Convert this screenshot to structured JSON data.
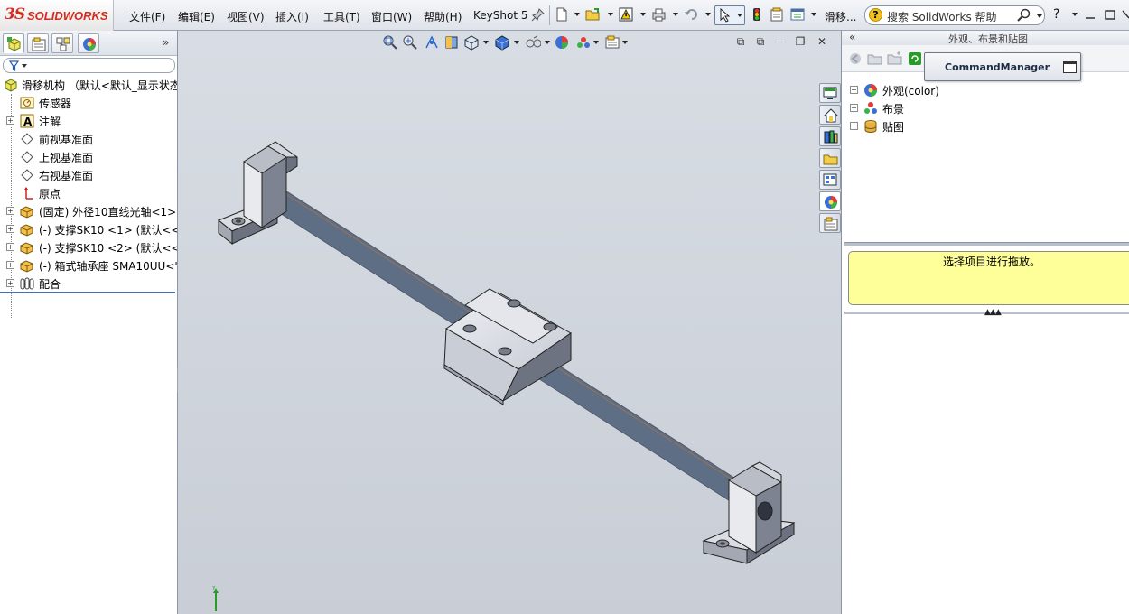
{
  "app": {
    "logo_text": "SOLIDWORKS",
    "logo_ds": "3S"
  },
  "menubar": {
    "items": [
      "文件(F)",
      "编辑(E)",
      "视图(V)",
      "插入(I)",
      "工具(T)",
      "窗口(W)",
      "帮助(H)",
      "KeyShot 5"
    ],
    "doc_title": "滑移...",
    "search_placeholder": "搜索 SolidWorks 帮助",
    "help_label": "?"
  },
  "feature_tree": {
    "root": "滑移机构 （默认<默认_显示状态",
    "items": [
      {
        "label": "传感器",
        "icon": "sensor-icon",
        "expandable": false
      },
      {
        "label": "注解",
        "icon": "annotation-icon",
        "expandable": true
      },
      {
        "label": "前视基准面",
        "icon": "plane-icon",
        "expandable": false
      },
      {
        "label": "上视基准面",
        "icon": "plane-icon",
        "expandable": false
      },
      {
        "label": "右视基准面",
        "icon": "plane-icon",
        "expandable": false
      },
      {
        "label": "原点",
        "icon": "origin-icon",
        "expandable": false
      },
      {
        "label": "(固定) 外径10直线光轴<1>",
        "icon": "part-icon",
        "expandable": true
      },
      {
        "label": "(-) 支撑SK10 <1> (默认<<!",
        "icon": "part-icon",
        "expandable": true
      },
      {
        "label": "(-) 支撑SK10 <2> (默认<<!",
        "icon": "part-icon",
        "expandable": true
      },
      {
        "label": "(-) 箱式轴承座 SMA10UU<'",
        "icon": "part-icon",
        "expandable": true
      },
      {
        "label": "配合",
        "icon": "mates-icon",
        "expandable": true
      }
    ]
  },
  "task_pane": {
    "header_title": "外观、布景和贴图",
    "command_manager_label": "CommandManager",
    "tree": [
      {
        "label": "外观(color)",
        "icon": "appearance-icon"
      },
      {
        "label": "布景",
        "icon": "scene-icon"
      },
      {
        "label": "贴图",
        "icon": "decal-icon"
      }
    ],
    "hint": "选择项目进行拖放。"
  },
  "colors": {
    "accent_blue": "#4a6fa5",
    "logo_red": "#d52b1e",
    "hint_yellow": "#ffff9a",
    "viewport_bg": "#d3d8df"
  }
}
